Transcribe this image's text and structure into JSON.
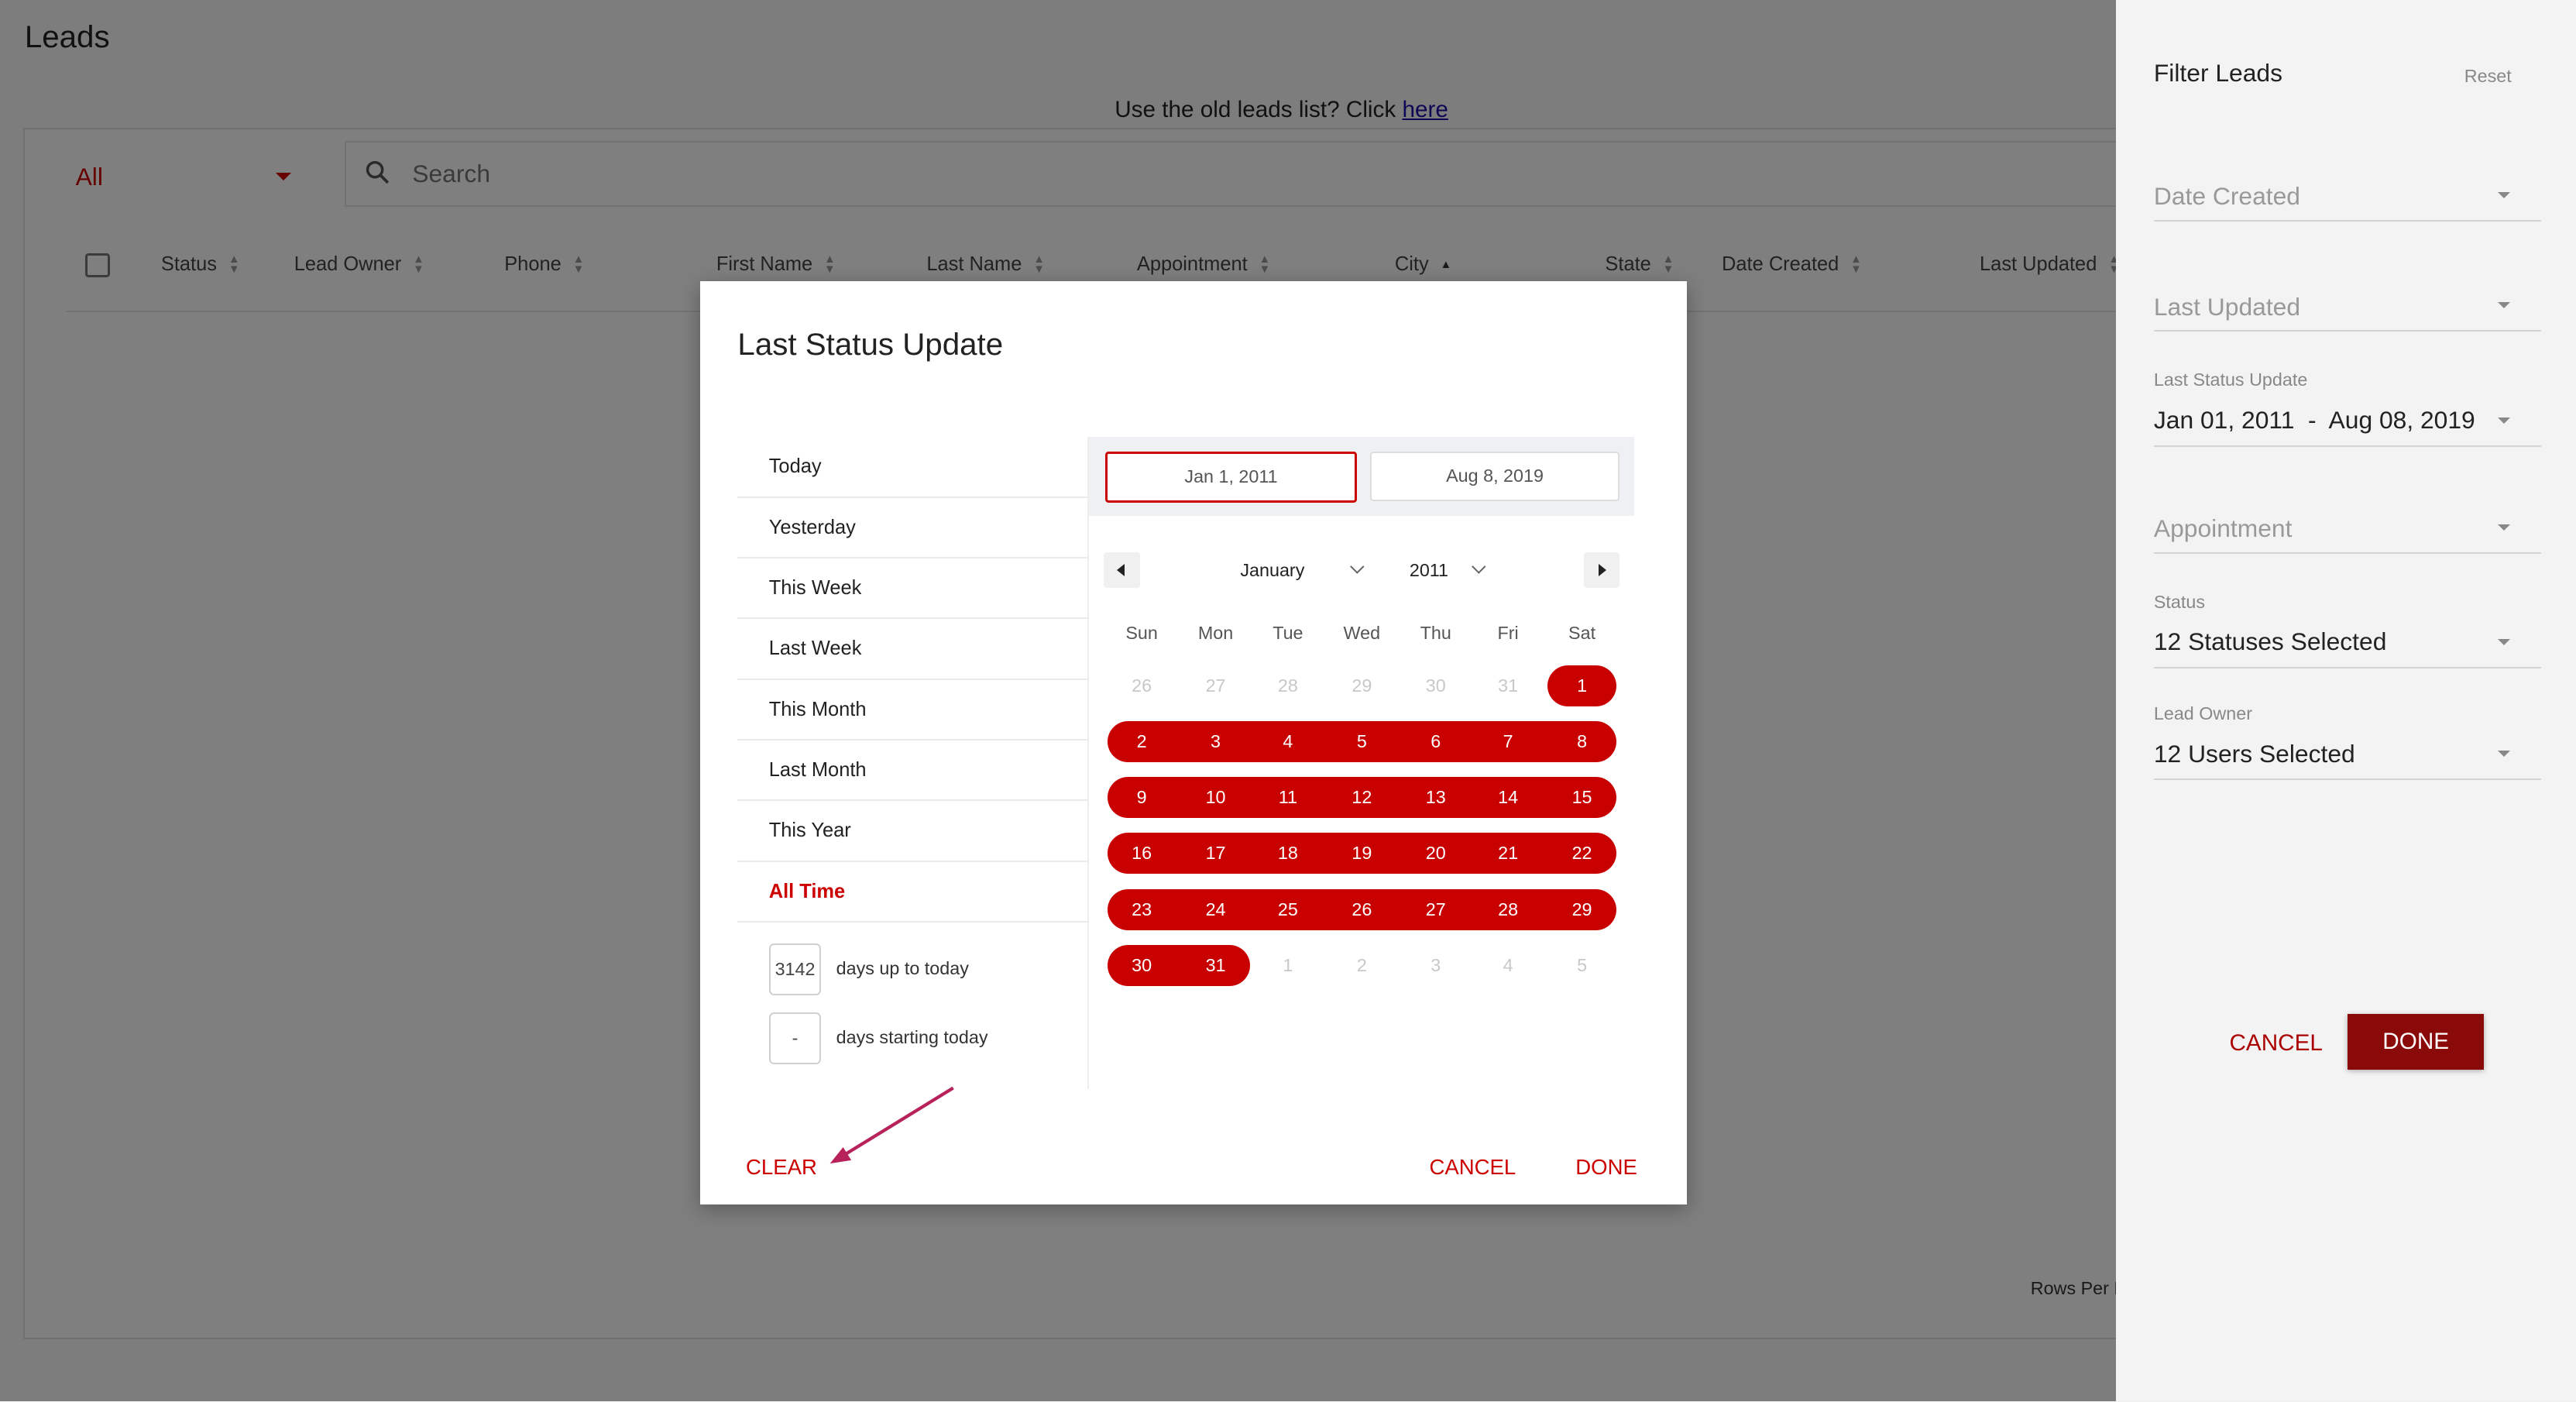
{
  "page": {
    "title": "Leads",
    "old_list_text": "Use the old leads list? Click ",
    "old_list_link": "here",
    "status_filter": "All",
    "search_placeholder": "Search",
    "columns": [
      "Status",
      "Lead Owner",
      "Phone",
      "First Name",
      "Last Name",
      "Appointment",
      "City",
      "State",
      "Date Created",
      "Last Updated"
    ],
    "rows_per_page": "Rows Per P"
  },
  "panel": {
    "title": "Filter Leads",
    "reset": "Reset",
    "date_created": "Date Created",
    "last_updated": "Last Updated",
    "last_status_update_label": "Last Status Update",
    "last_status_update_value": "Jan 01, 2011  -  Aug 08, 2019",
    "appointment": "Appointment",
    "status_label": "Status",
    "status_value": "12 Statuses Selected",
    "lead_owner_label": "Lead Owner",
    "lead_owner_value": "12 Users Selected",
    "cancel": "CANCEL",
    "done": "DONE"
  },
  "modal": {
    "title": "Last Status Update",
    "presets": [
      "Today",
      "Yesterday",
      "This Week",
      "Last Week",
      "This Month",
      "Last Month",
      "This Year",
      "All Time"
    ],
    "active_preset": "All Time",
    "days_up_value": "3142",
    "days_up_label": "days up to today",
    "days_start_value": "-",
    "days_start_label": "days starting today",
    "start_date": "Jan 1, 2011",
    "end_date": "Aug 8, 2019",
    "month": "January",
    "year": "2011",
    "weekdays": [
      "Sun",
      "Mon",
      "Tue",
      "Wed",
      "Thu",
      "Fri",
      "Sat"
    ],
    "weeks": [
      [
        "26",
        "27",
        "28",
        "29",
        "30",
        "31",
        "1"
      ],
      [
        "2",
        "3",
        "4",
        "5",
        "6",
        "7",
        "8"
      ],
      [
        "9",
        "10",
        "11",
        "12",
        "13",
        "14",
        "15"
      ],
      [
        "16",
        "17",
        "18",
        "19",
        "20",
        "21",
        "22"
      ],
      [
        "23",
        "24",
        "25",
        "26",
        "27",
        "28",
        "29"
      ],
      [
        "30",
        "31",
        "1",
        "2",
        "3",
        "4",
        "5"
      ]
    ],
    "clear": "CLEAR",
    "cancel": "CANCEL",
    "done": "DONE"
  },
  "colors": {
    "accent": "#c80000",
    "done_button": "#8a0a0a"
  }
}
